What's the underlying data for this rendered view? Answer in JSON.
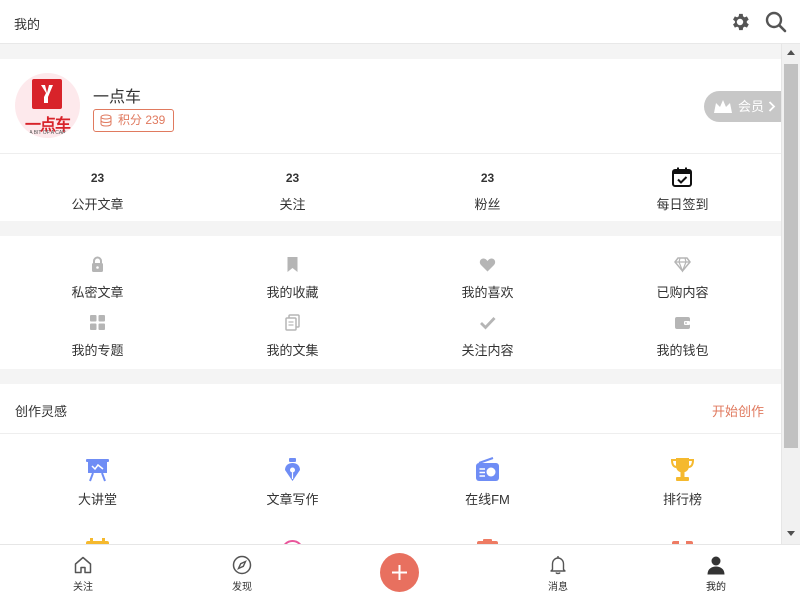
{
  "header": {
    "title": "我的"
  },
  "profile": {
    "avatar_logo_text": "一点车",
    "avatar_logo_sub": "A BIT OF A CAR",
    "username": "一点车",
    "points_label": "积分 239",
    "vip_label": "会员"
  },
  "stats": [
    {
      "value": "23",
      "label": "公开文章"
    },
    {
      "value": "23",
      "label": "关注"
    },
    {
      "value": "23",
      "label": "粉丝"
    },
    {
      "label": "每日签到"
    }
  ],
  "features": [
    {
      "label": "私密文章",
      "icon": "lock-icon"
    },
    {
      "label": "我的收藏",
      "icon": "bookmark-icon"
    },
    {
      "label": "我的喜欢",
      "icon": "heart-icon"
    },
    {
      "label": "已购内容",
      "icon": "diamond-icon"
    },
    {
      "label": "我的专题",
      "icon": "grid-icon"
    },
    {
      "label": "我的文集",
      "icon": "documents-icon"
    },
    {
      "label": "关注内容",
      "icon": "check-icon"
    },
    {
      "label": "我的钱包",
      "icon": "wallet-icon"
    }
  ],
  "inspiration": {
    "title": "创作灵感",
    "action": "开始创作",
    "items": [
      {
        "label": "大讲堂",
        "icon": "easel-icon"
      },
      {
        "label": "文章写作",
        "icon": "fountain-pen-icon"
      },
      {
        "label": "在线FM",
        "icon": "radio-icon"
      },
      {
        "label": "排行榜",
        "icon": "trophy-icon"
      }
    ]
  },
  "bottom_nav": [
    {
      "label": "关注",
      "icon": "home-icon"
    },
    {
      "label": "发现",
      "icon": "compass-icon"
    },
    {
      "label": "",
      "icon": "plus-icon"
    },
    {
      "label": "消息",
      "icon": "bell-icon"
    },
    {
      "label": "我的",
      "icon": "user-icon"
    }
  ],
  "colors": {
    "accent": "#e07a5f",
    "plus_button": "#e8705f",
    "icon_gray": "#b5b5b5",
    "vip_bg": "#c7c7c7"
  }
}
